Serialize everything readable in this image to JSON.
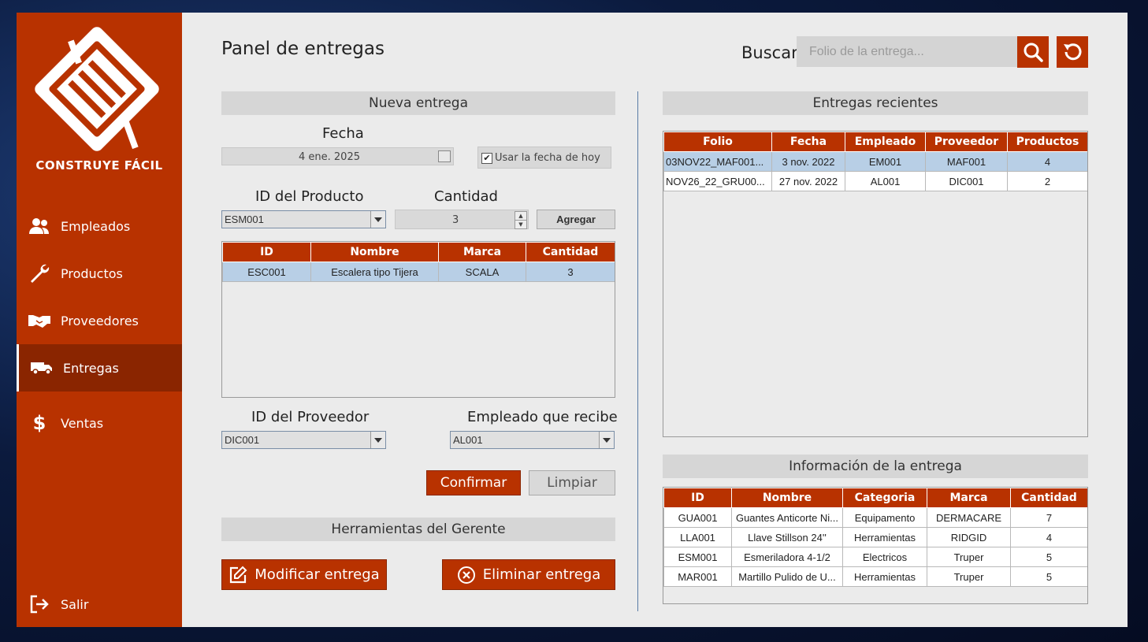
{
  "sidebar": {
    "brand": "CONSTRUYE FÁCIL",
    "items": [
      {
        "label": "Empleados",
        "icon": "users-icon"
      },
      {
        "label": "Productos",
        "icon": "wrench-icon"
      },
      {
        "label": "Proveedores",
        "icon": "handshake-icon"
      },
      {
        "label": "Entregas",
        "icon": "truck-icon"
      },
      {
        "label": "Ventas",
        "icon": "dollar-icon"
      }
    ],
    "logout": "Salir"
  },
  "header": {
    "title": "Panel de entregas",
    "search_label": "Buscar",
    "search_placeholder": "Folio de la entrega..."
  },
  "nueva": {
    "section_title": "Nueva entrega",
    "fecha_label": "Fecha",
    "fecha_value": "4 ene. 2025",
    "usar_hoy_label": "Usar la fecha de hoy",
    "usar_hoy_checked": true,
    "producto_label": "ID del Producto",
    "producto_value": "ESM001",
    "cantidad_label": "Cantidad",
    "cantidad_value": "3",
    "agregar": "Agregar",
    "table": {
      "headers": [
        "ID",
        "Nombre",
        "Marca",
        "Cantidad"
      ],
      "rows": [
        [
          "ESC001",
          "Escalera tipo Tijera",
          "SCALA",
          "3"
        ]
      ]
    },
    "proveedor_label": "ID del Proveedor",
    "proveedor_value": "DIC001",
    "empleado_label": "Empleado que recibe",
    "empleado_value": "AL001",
    "confirmar": "Confirmar",
    "limpiar": "Limpiar"
  },
  "gerente": {
    "section_title": "Herramientas del Gerente",
    "modificar": "Modificar entrega",
    "eliminar": "Eliminar entrega"
  },
  "recientes": {
    "section_title": "Entregas recientes",
    "headers": [
      "Folio",
      "Fecha",
      "Empleado",
      "Proveedor",
      "Productos"
    ],
    "rows": [
      [
        "03NOV22_MAF001...",
        "3 nov. 2022",
        "EM001",
        "MAF001",
        "4"
      ],
      [
        "NOV26_22_GRU00...",
        "27 nov. 2022",
        "AL001",
        "DIC001",
        "2"
      ]
    ]
  },
  "info": {
    "section_title": "Información de la entrega",
    "headers": [
      "ID",
      "Nombre",
      "Categoria",
      "Marca",
      "Cantidad"
    ],
    "rows": [
      [
        "GUA001",
        "Guantes Anticorte Ni...",
        "Equipamento",
        "DERMACARE",
        "7"
      ],
      [
        "LLA001",
        "Llave Stillson 24''",
        "Herramientas",
        "RIDGID",
        "4"
      ],
      [
        "ESM001",
        "Esmeriladora 4-1/2",
        "Electricos",
        "Truper",
        "5"
      ],
      [
        "MAR001",
        "Martillo Pulido de U...",
        "Herramientas",
        "Truper",
        "5"
      ]
    ]
  },
  "colors": {
    "accent": "#b83200",
    "accent_dark": "#8a2500",
    "selection": "#b8cfe6"
  }
}
